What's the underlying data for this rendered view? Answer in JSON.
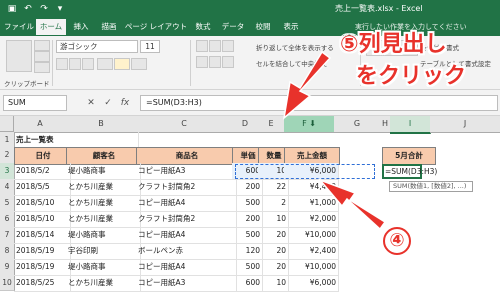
{
  "window": {
    "title": "売上一覧表.xlsx - Excel"
  },
  "ribbon_tabs": [
    "ファイル",
    "ホーム",
    "挿入",
    "描画",
    "ページ レイアウト",
    "数式",
    "データ",
    "校閲",
    "表示"
  ],
  "active_tab": "ホーム",
  "tell_me": "実行したい作業を入力してください",
  "ribbon": {
    "font_name": "游ゴシック",
    "font_size": "11",
    "clipboard_label": "クリップボード",
    "wrap_text": "折り返して全体を表示する",
    "merge_center": "セルを結合して中央揃え",
    "conditional_format": "条件付き書式",
    "table_format": "テーブルとして書式設定"
  },
  "formula_bar": {
    "name_box": "SUM",
    "formula": "=SUM(D3:H3)"
  },
  "columns": [
    "A",
    "B",
    "C",
    "D",
    "E",
    "F",
    "G",
    "H",
    "I",
    "J"
  ],
  "selected_column": "F",
  "rows": [
    "1",
    "2",
    "3",
    "4",
    "5",
    "6",
    "7",
    "8",
    "9",
    "10"
  ],
  "sheet": {
    "title": "売上一覧表",
    "headers": [
      "日付",
      "顧客名",
      "商品名",
      "単価",
      "数量",
      "売上金額"
    ],
    "rows": [
      [
        "2018/5/2",
        "堤小路商事",
        "コピー用紙A3",
        "600",
        "10",
        "¥6,000"
      ],
      [
        "2018/5/5",
        "とかち川産業",
        "クラフト封筒角2",
        "200",
        "22",
        "¥4,400"
      ],
      [
        "2018/5/10",
        "とかち川産業",
        "コピー用紙A4",
        "500",
        "2",
        "¥1,000"
      ],
      [
        "2018/5/10",
        "とかち川産業",
        "クラフト封筒角2",
        "200",
        "10",
        "¥2,000"
      ],
      [
        "2018/5/14",
        "堤小路商事",
        "コピー用紙A4",
        "500",
        "20",
        "¥10,000"
      ],
      [
        "2018/5/19",
        "宇谷印刷",
        "ボールペン赤",
        "120",
        "20",
        "¥2,400"
      ],
      [
        "2018/5/19",
        "堤小路商事",
        "コピー用紙A4",
        "500",
        "20",
        "¥10,000"
      ],
      [
        "2018/5/25",
        "とかち川産業",
        "コピー用紙A3",
        "600",
        "10",
        "¥6,000"
      ]
    ],
    "monthly_header": "5月合計",
    "active_cell_text": "=SUM(D3:H3)",
    "tooltip": "SUM(数値1, [数値2], ...)"
  },
  "annotations": {
    "step5_line1": "⑤列見出し",
    "step5_line2": "をクリック",
    "step4": "④"
  },
  "colors": {
    "excel_green": "#217346",
    "header_fill": "#f8cbad",
    "callout_red": "#e8322b"
  }
}
